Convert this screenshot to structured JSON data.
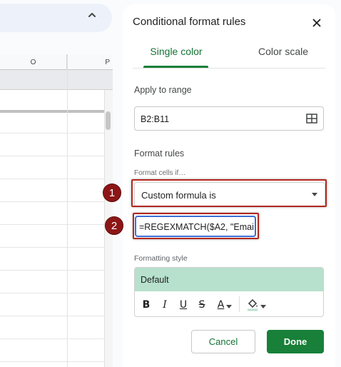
{
  "sheet": {
    "columns": [
      "O",
      "P"
    ]
  },
  "panel": {
    "title": "Conditional format rules",
    "tabs": [
      {
        "label": "Single color",
        "active": true
      },
      {
        "label": "Color scale",
        "active": false
      }
    ],
    "apply_to_range": {
      "label": "Apply to range",
      "value": "B2:B11"
    },
    "format_rules": {
      "label": "Format rules",
      "condition_label": "Format cells if…",
      "condition_value": "Custom formula is",
      "formula_value": "=REGEXMATCH($A2, \"Emai"
    },
    "formatting_style": {
      "label": "Formatting style",
      "preview": "Default",
      "preview_color": "#b7e1cd",
      "tools": [
        "bold-icon",
        "italic-icon",
        "underline-icon",
        "strikethrough-icon",
        "text-color-icon",
        "fill-color-icon"
      ]
    },
    "buttons": {
      "cancel": "Cancel",
      "done": "Done"
    }
  },
  "annotations": {
    "badge_1": "1",
    "badge_2": "2",
    "highlight_color": "#b3261e"
  },
  "colors": {
    "accent_green": "#188038",
    "badge_red": "#8c1616"
  }
}
